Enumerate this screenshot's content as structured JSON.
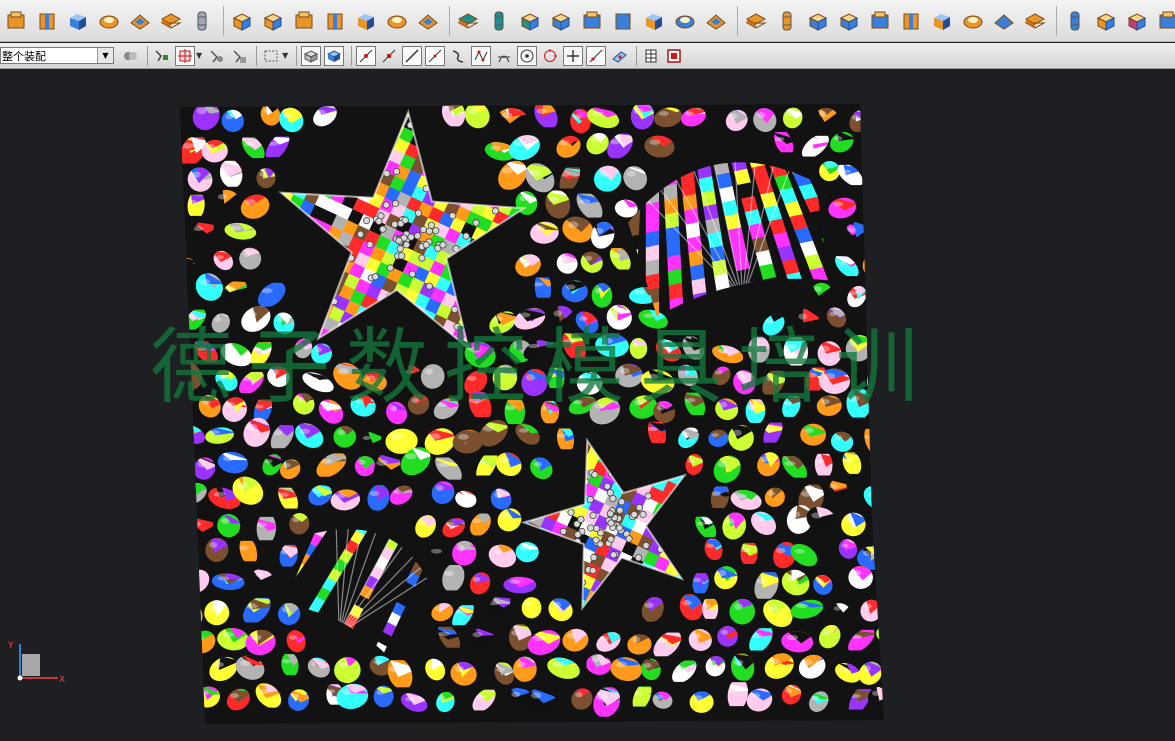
{
  "toolbar_top": {
    "buttons": [
      {
        "name": "assembly-icon",
        "color": "#e8962a"
      },
      {
        "name": "component-icon",
        "color": "#e8962a"
      },
      {
        "name": "block-icon",
        "color": "#3b7fd8"
      },
      {
        "name": "pad-icon",
        "color": "#e8962a"
      },
      {
        "name": "surface-icon",
        "color": "#e8962a"
      },
      {
        "name": "layer-icon",
        "color": "#e8962a"
      },
      {
        "name": "cylinder-icon",
        "color": "#9fa8b8"
      },
      {
        "name": "pattern-icon",
        "color": "#e8962a"
      },
      {
        "name": "feature-icon",
        "color": "#e8962a"
      },
      {
        "name": "array-icon",
        "color": "#e8962a"
      },
      {
        "name": "hole-array-icon",
        "color": "#e8962a"
      },
      {
        "name": "cube-set-icon",
        "color": "#e8962a"
      },
      {
        "name": "grid-icon",
        "color": "#e8962a"
      },
      {
        "name": "cube-edit-icon",
        "color": "#e8962a"
      },
      {
        "name": "unite-icon",
        "color": "#1f8f8f"
      },
      {
        "name": "subtract-icon",
        "color": "#1f8f8f"
      },
      {
        "name": "intersect-icon",
        "color": "#1f8f8f"
      },
      {
        "name": "book-icon",
        "color": "#3b7fd8"
      },
      {
        "name": "mirror-icon",
        "color": "#3b7fd8"
      },
      {
        "name": "extract-icon",
        "color": "#3b7fd8"
      },
      {
        "name": "box-icon",
        "color": "#e8962a"
      },
      {
        "name": "hollow-box-icon",
        "color": "#3b7fd8"
      },
      {
        "name": "open-book-icon",
        "color": "#e8962a"
      },
      {
        "name": "sheet-icon",
        "color": "#e8962a"
      },
      {
        "name": "bend-icon",
        "color": "#e8962a"
      },
      {
        "name": "twist-icon",
        "color": "#3b7fd8"
      },
      {
        "name": "plate-icon",
        "color": "#3b7fd8"
      },
      {
        "name": "stack-icon",
        "color": "#3b7fd8"
      },
      {
        "name": "sheet-metal-icon",
        "color": "#e8962a"
      },
      {
        "name": "gear-icon",
        "color": "#e8962a"
      },
      {
        "name": "bucket-icon",
        "color": "#e8962a"
      },
      {
        "name": "shell-icon",
        "color": "#3b7fd8"
      },
      {
        "name": "thicken-icon",
        "color": "#e8962a"
      },
      {
        "name": "offset-face-icon",
        "color": "#3b7fd8"
      },
      {
        "name": "flange-icon",
        "color": "#e8962a"
      },
      {
        "name": "draft-icon",
        "color": "#c23b7a"
      },
      {
        "name": "wireframe-cube-icon",
        "color": "#3b7fd8"
      }
    ]
  },
  "toolbar_bottom": {
    "scope_select": {
      "value": "整个装配"
    },
    "buttons": [
      {
        "name": "part-filter-icon"
      },
      {
        "name": "snap-settings-icon"
      },
      {
        "name": "snap-point-icon"
      },
      {
        "name": "select-solid-icon"
      },
      {
        "name": "select-body-icon"
      },
      {
        "name": "rect-select-icon"
      },
      {
        "name": "view-solid-icon"
      },
      {
        "name": "view-shaded-icon"
      },
      {
        "name": "end-point-icon"
      },
      {
        "name": "mid-point-icon"
      },
      {
        "name": "line-icon"
      },
      {
        "name": "tangent-line-icon"
      },
      {
        "name": "curve-icon"
      },
      {
        "name": "control-point-icon"
      },
      {
        "name": "intersection-icon"
      },
      {
        "name": "arc-center-icon"
      },
      {
        "name": "quadrant-icon"
      },
      {
        "name": "existing-point-icon"
      },
      {
        "name": "point-on-curve-icon"
      },
      {
        "name": "point-on-face-icon"
      },
      {
        "name": "table-icon"
      },
      {
        "name": "stop-icon"
      }
    ]
  },
  "watermark": {
    "text": "德子数控模具培训"
  },
  "triad": {
    "y_label": "Y",
    "x_label": "X"
  }
}
